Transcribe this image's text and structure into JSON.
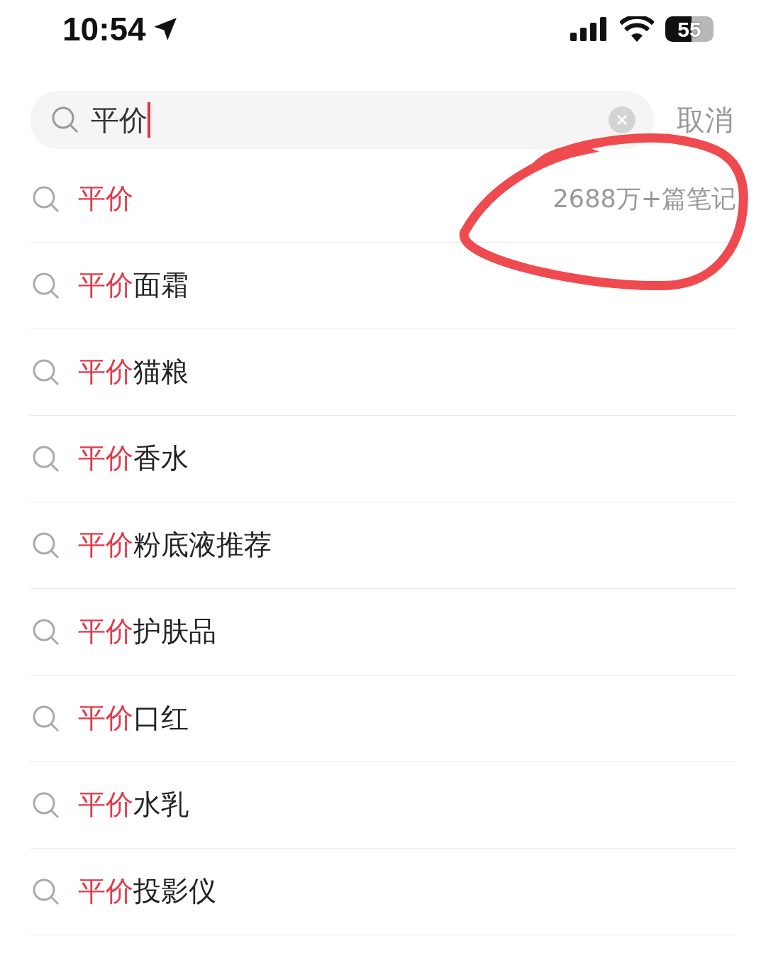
{
  "status_bar": {
    "time": "10:54",
    "battery": "55"
  },
  "search": {
    "value": "平价",
    "cancel": "取消"
  },
  "suggestions": [
    {
      "highlight": "平价",
      "count": "2688万+篇笔记"
    },
    {
      "highlight": "平价",
      "suffix": "面霜"
    },
    {
      "highlight": "平价",
      "suffix": "猫粮"
    },
    {
      "highlight": "平价",
      "suffix": "香水"
    },
    {
      "highlight": "平价",
      "suffix": "粉底液推荐"
    },
    {
      "highlight": "平价",
      "suffix": "护肤品"
    },
    {
      "highlight": "平价",
      "suffix": "口红"
    },
    {
      "highlight": "平价",
      "suffix": "水乳"
    },
    {
      "highlight": "平价",
      "suffix": "投影仪"
    }
  ]
}
